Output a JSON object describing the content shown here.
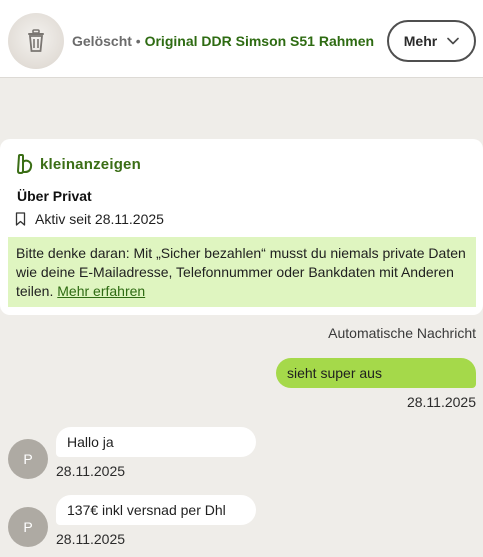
{
  "header": {
    "status": "Gelöscht",
    "separator": "•",
    "listing_title": "Original DDR Simson S51 Rahmen",
    "more_button": "Mehr",
    "thumbnail_icon": "trash-icon"
  },
  "card": {
    "brand": "kleinanzeigen",
    "seller": "Über Privat",
    "active_since": "Aktiv seit 28.11.2025",
    "notice_text": "Bitte denke daran: Mit „Sicher bezahlen“ musst du niemals private Daten wie deine E-Mailadresse, Telefonnummer oder Bankdaten mit Anderen teilen.",
    "notice_link": "Mehr erfahren"
  },
  "chat": {
    "auto_message": "Automatische Nachricht",
    "messages": [
      {
        "direction": "out",
        "text": "sieht super aus",
        "time": "28.11.2025"
      },
      {
        "direction": "in",
        "avatar": "P",
        "text": "Hallo ja",
        "time": "28.11.2025"
      },
      {
        "direction": "in",
        "avatar": "P",
        "text": "137€ inkl versnad per Dhl",
        "time": "28.11.2025"
      }
    ]
  },
  "colors": {
    "brand_green": "#3b6e16",
    "outgoing_bubble": "#a5d94a",
    "notice_bg": "#dff5c0",
    "page_bg": "#efede9"
  }
}
